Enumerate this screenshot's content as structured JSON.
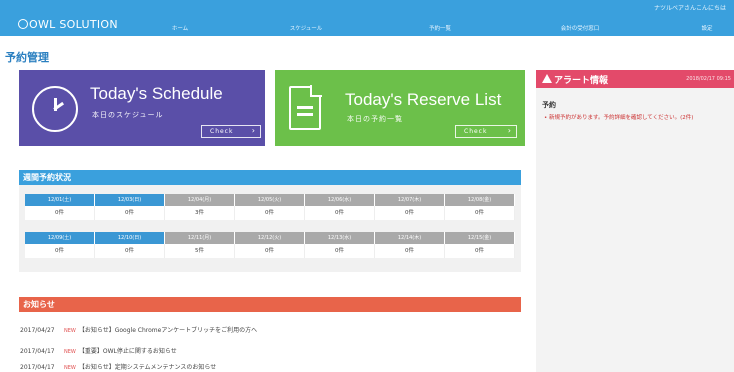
{
  "header": {
    "logo_text": "OWL SOLUTION",
    "user_text": "ナツルベアさんこんにちは",
    "nav": [
      {
        "label": "ホーム"
      },
      {
        "label": "スケジュール"
      },
      {
        "label": "予約一覧"
      },
      {
        "label": "会計の受付窓口"
      },
      {
        "label": "設定"
      }
    ]
  },
  "page_title": "予約管理",
  "schedule_panel": {
    "title": "Today's Schedule",
    "subtitle": "本日のスケジュール",
    "check_label": "Check"
  },
  "reserve_panel": {
    "title": "Today's Reserve List",
    "subtitle": "本日の予約一覧",
    "check_label": "Check"
  },
  "alert": {
    "title": "アラート情報",
    "date": "2018/02/17 09:15",
    "subtitle": "予約",
    "message": "• 新規予約があります。予約詳細を確認してください。(2件)"
  },
  "weekly": {
    "title": "週間予約状況",
    "row1": {
      "dates": [
        "12/01(土)",
        "12/03(日)",
        "12/04(月)",
        "12/05(火)",
        "12/06(水)",
        "12/07(木)",
        "12/08(金)"
      ],
      "values": [
        "0件",
        "0件",
        "3件",
        "0件",
        "0件",
        "0件",
        "0件"
      ]
    },
    "row2": {
      "dates": [
        "12/09(土)",
        "12/10(日)",
        "12/11(月)",
        "12/12(火)",
        "12/13(水)",
        "12/14(木)",
        "12/15(金)"
      ],
      "values": [
        "0件",
        "0件",
        "5件",
        "0件",
        "0件",
        "0件",
        "0件"
      ]
    }
  },
  "news": {
    "title": "お知らせ",
    "new_label": "NEW",
    "items": [
      {
        "date": "2017/04/27",
        "text": "【お知らせ】Google Chromeアンケートブリッチをご利用の方へ"
      },
      {
        "date": "2017/04/17",
        "text": "【重要】OWL停止に関するお知らせ"
      },
      {
        "date": "2017/04/17",
        "text": "【お知らせ】定期システムメンテナンスのお知らせ"
      }
    ]
  },
  "colors": {
    "topbar": "#3aa0dd",
    "schedule_panel": "#5a4fa8",
    "reserve_panel": "#6cc04a",
    "alert_header": "#e34a6a",
    "news_header": "#e8644a"
  }
}
